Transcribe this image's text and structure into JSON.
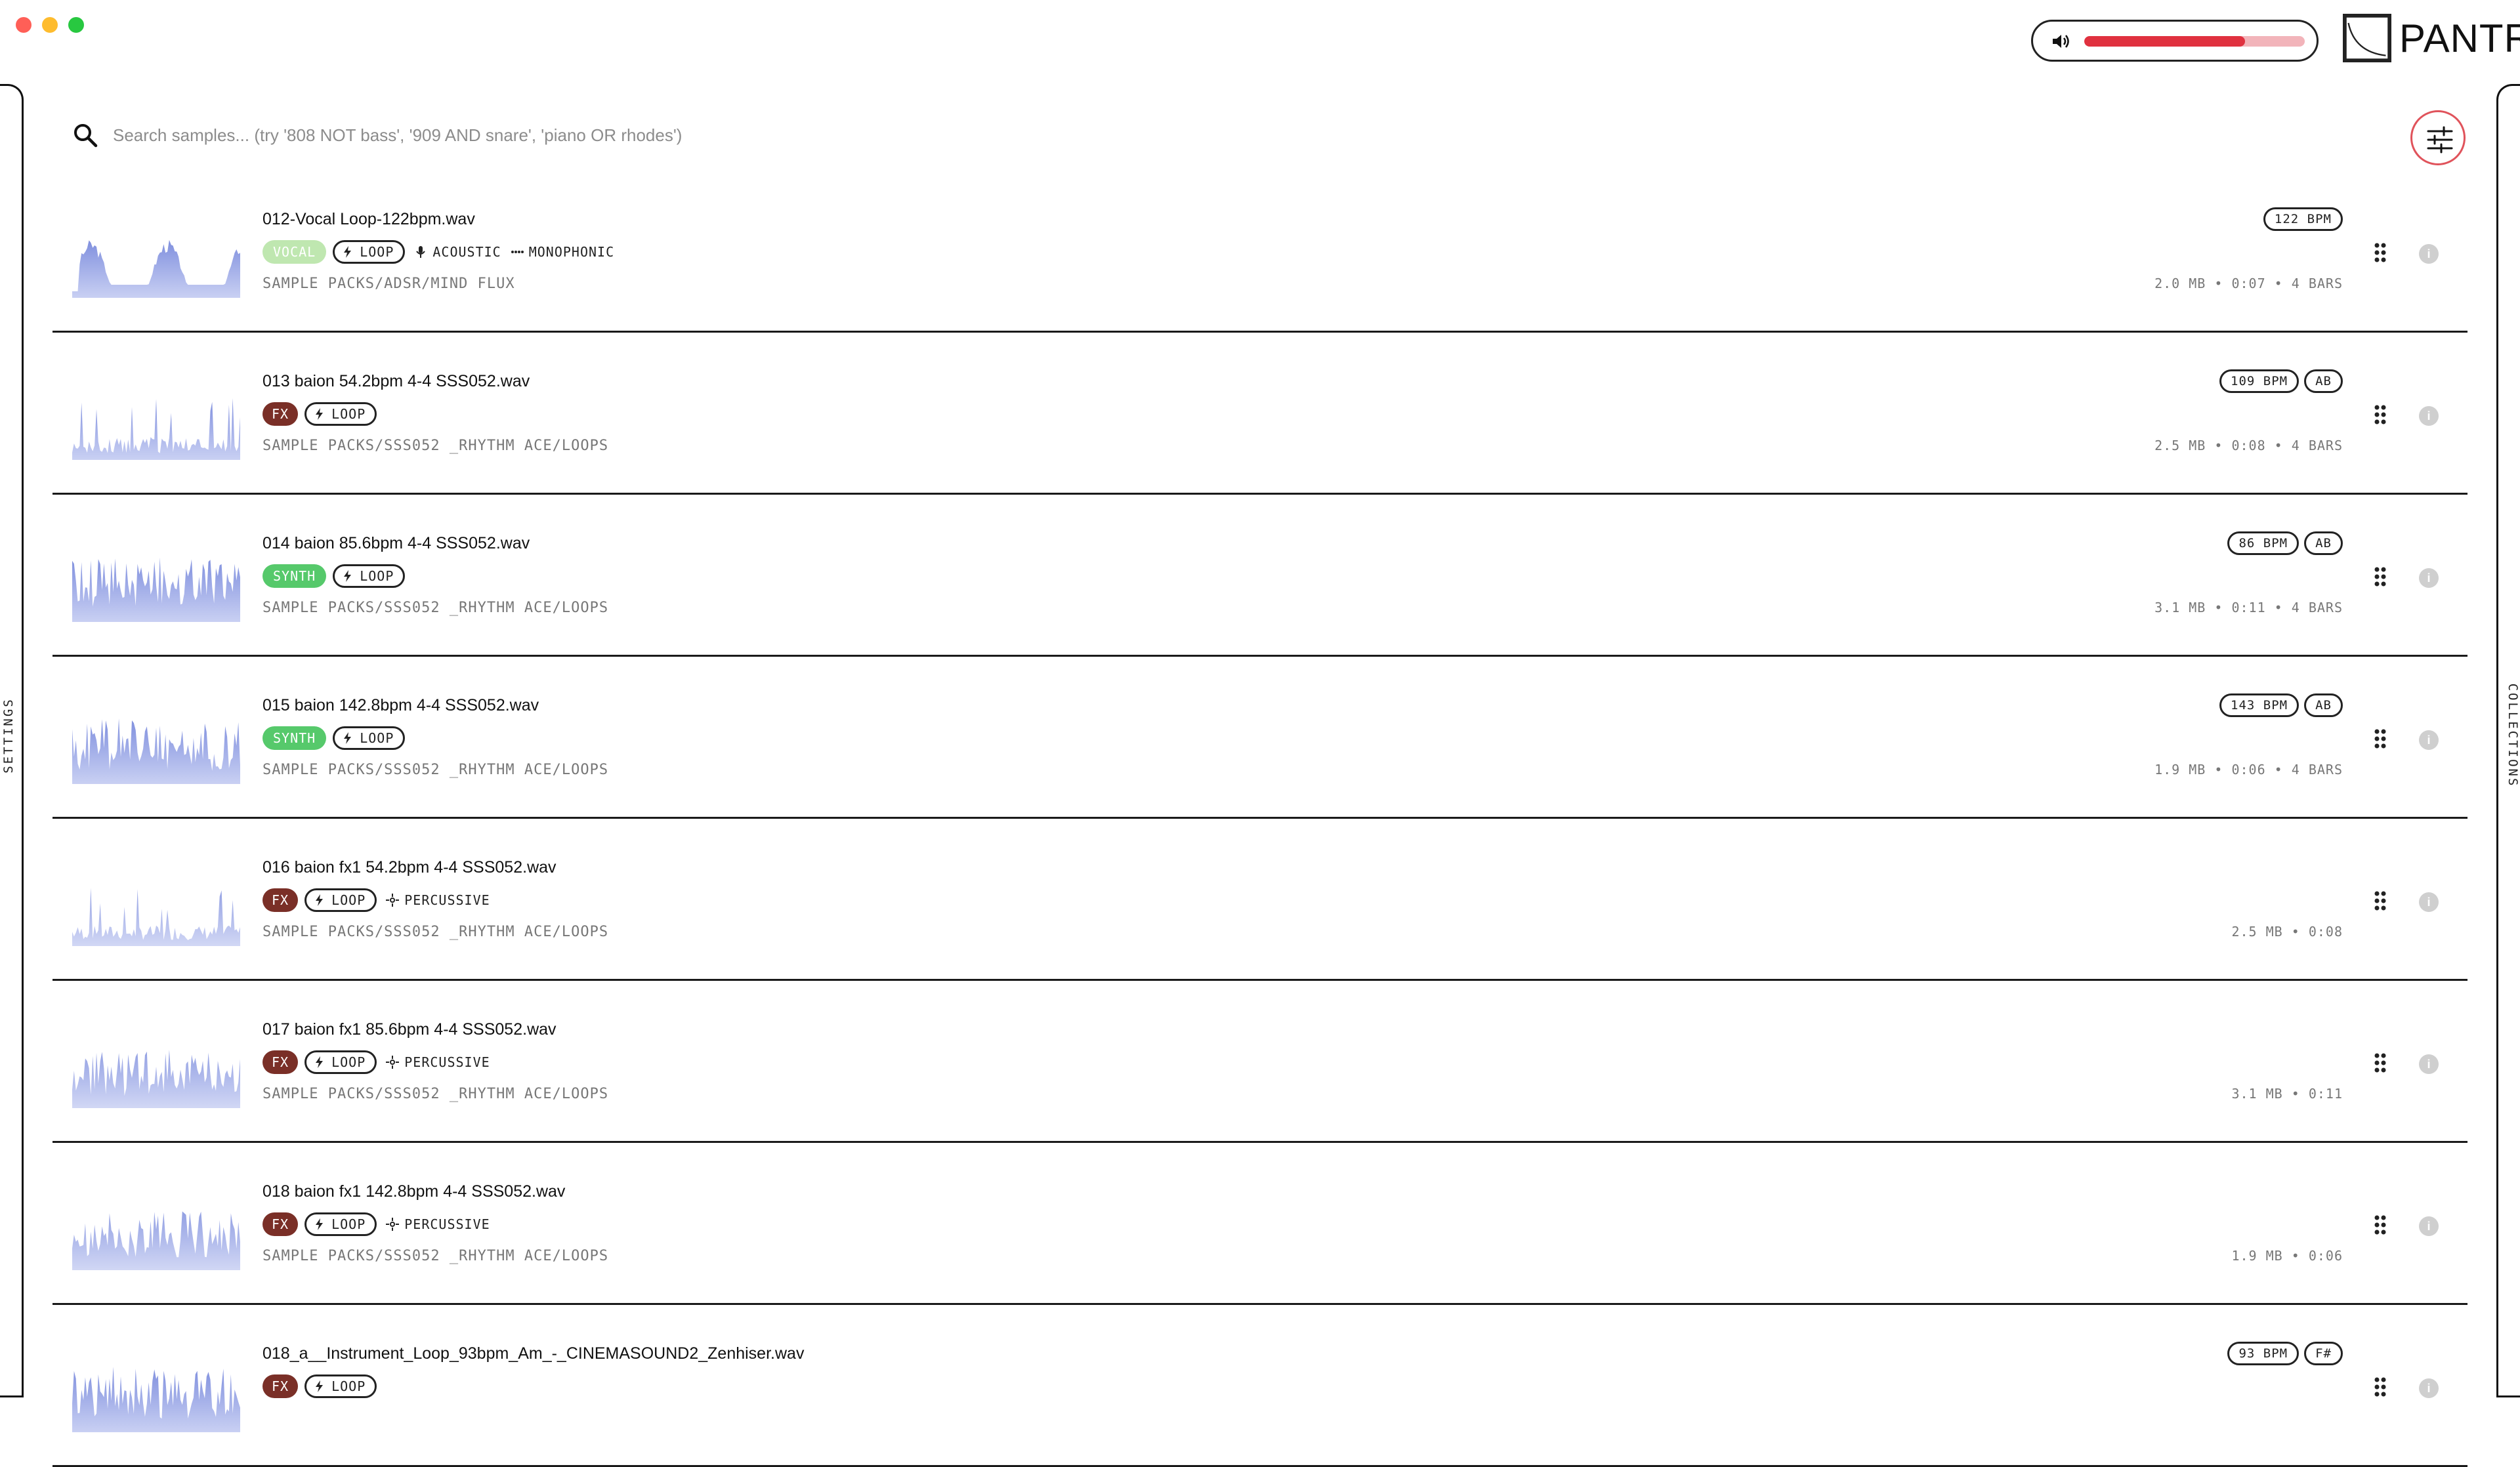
{
  "window": {
    "buttons": [
      "close",
      "minimize",
      "maximize"
    ]
  },
  "header": {
    "volume_level": 0.73,
    "volume_icon": "speaker-icon",
    "logo_text": "PANTRY"
  },
  "rails": {
    "left_label": "SETTINGS",
    "right_label": "COLLECTIONS"
  },
  "search": {
    "placeholder": "Search samples... (try '808 NOT bass', '909 AND snare', 'piano OR rhodes')",
    "value": "",
    "icon": "search-icon",
    "filter_icon": "sliders-icon"
  },
  "colors": {
    "accent": "#e0313f",
    "vocal_tag": "#bfe7b0",
    "fx_tag": "#7a2f27",
    "synth_tag": "#56c96b",
    "waveform": "#7f8fde"
  },
  "samples": [
    {
      "title": "012-Vocal Loop-122bpm.wav",
      "tags": [
        {
          "type": "category",
          "label": "VOCAL",
          "style": "vocal"
        },
        {
          "type": "loop",
          "label": "LOOP"
        },
        {
          "type": "meta",
          "label": "ACOUSTIC",
          "icon": "microphone-icon"
        },
        {
          "type": "meta",
          "label": "MONOPHONIC",
          "icon": "dots-icon"
        }
      ],
      "path": "SAMPLE PACKS/ADSR/MIND FLUX",
      "badges": [
        "122 BPM"
      ],
      "stats": "2.0 MB • 0:07 • 4 BARS",
      "wave": "vocal"
    },
    {
      "title": "013 baion 54.2bpm 4-4 SSS052.wav",
      "tags": [
        {
          "type": "category",
          "label": "FX",
          "style": "fx"
        },
        {
          "type": "loop",
          "label": "LOOP"
        }
      ],
      "path": "SAMPLE PACKS/SSS052 _RHYTHM ACE/LOOPS",
      "badges": [
        "109 BPM",
        "AB"
      ],
      "stats": "2.5 MB • 0:08 • 4 BARS",
      "wave": "sparse"
    },
    {
      "title": "014 baion 85.6bpm 4-4 SSS052.wav",
      "tags": [
        {
          "type": "category",
          "label": "SYNTH",
          "style": "synth"
        },
        {
          "type": "loop",
          "label": "LOOP"
        }
      ],
      "path": "SAMPLE PACKS/SSS052 _RHYTHM ACE/LOOPS",
      "badges": [
        "86 BPM",
        "AB"
      ],
      "stats": "3.1 MB • 0:11 • 4 BARS",
      "wave": "dense"
    },
    {
      "title": "015 baion 142.8bpm 4-4 SSS052.wav",
      "tags": [
        {
          "type": "category",
          "label": "SYNTH",
          "style": "synth"
        },
        {
          "type": "loop",
          "label": "LOOP"
        }
      ],
      "path": "SAMPLE PACKS/SSS052 _RHYTHM ACE/LOOPS",
      "badges": [
        "143 BPM",
        "AB"
      ],
      "stats": "1.9 MB • 0:06 • 4 BARS",
      "wave": "dense"
    },
    {
      "title": "016 baion fx1 54.2bpm 4-4 SSS052.wav",
      "tags": [
        {
          "type": "category",
          "label": "FX",
          "style": "fx"
        },
        {
          "type": "loop",
          "label": "LOOP"
        },
        {
          "type": "meta",
          "label": "PERCUSSIVE",
          "icon": "sparkle-icon"
        }
      ],
      "path": "SAMPLE PACKS/SSS052 _RHYTHM ACE/LOOPS",
      "badges": [],
      "stats": "2.5 MB • 0:08",
      "wave": "sparse-light"
    },
    {
      "title": "017 baion fx1 85.6bpm 4-4 SSS052.wav",
      "tags": [
        {
          "type": "category",
          "label": "FX",
          "style": "fx"
        },
        {
          "type": "loop",
          "label": "LOOP"
        },
        {
          "type": "meta",
          "label": "PERCUSSIVE",
          "icon": "sparkle-icon"
        }
      ],
      "path": "SAMPLE PACKS/SSS052 _RHYTHM ACE/LOOPS",
      "badges": [],
      "stats": "3.1 MB • 0:11",
      "wave": "dense-light"
    },
    {
      "title": "018 baion fx1 142.8bpm 4-4 SSS052.wav",
      "tags": [
        {
          "type": "category",
          "label": "FX",
          "style": "fx"
        },
        {
          "type": "loop",
          "label": "LOOP"
        },
        {
          "type": "meta",
          "label": "PERCUSSIVE",
          "icon": "sparkle-icon"
        }
      ],
      "path": "SAMPLE PACKS/SSS052 _RHYTHM ACE/LOOPS",
      "badges": [],
      "stats": "1.9 MB • 0:06",
      "wave": "dense-light"
    },
    {
      "title": "018_a__Instrument_Loop_93bpm_Am_-_CINEMASOUND2_Zenhiser.wav",
      "tags": [
        {
          "type": "category",
          "label": "FX",
          "style": "fx"
        },
        {
          "type": "loop",
          "label": "LOOP"
        }
      ],
      "path": "",
      "badges": [
        "93 BPM",
        "F#"
      ],
      "stats": "",
      "wave": "dense"
    }
  ]
}
